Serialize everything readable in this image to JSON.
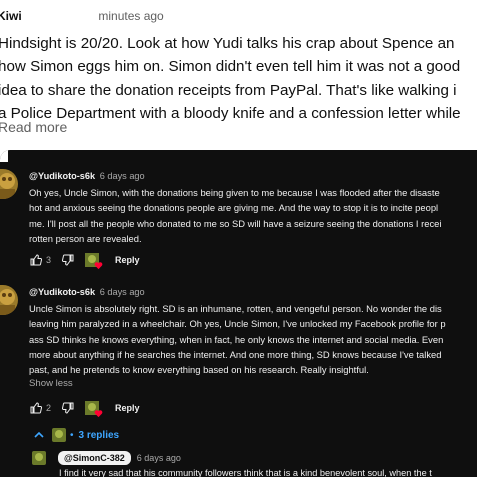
{
  "top_comment": {
    "author": "Kiwi",
    "time_fragment": "minutes ago",
    "lines": [
      "Hindsight is 20/20. Look at how Yudi talks his crap about Spence an",
      "how Simon eggs him on. Simon didn't even tell him it was not a good",
      "idea to share the donation receipts from PayPal. That's like walking i",
      "a Police Department with a bloody knife and a confession letter while"
    ],
    "read_more": "Read more"
  },
  "replies": [
    {
      "handle": "@Yudikoto-s6k",
      "ago": "6 days ago",
      "lines": [
        "Oh yes, Uncle Simon, with the donations being given to me because I was flooded after the disaste",
        "hot and anxious seeing the donations people are giving me. And the way to stop it is to incite peopl",
        "me. I'll post all the people who donated to me so SD will have a seizure seeing the donations I recei",
        "rotten person are revealed."
      ],
      "likes": "3",
      "reply_label": "Reply"
    },
    {
      "handle": "@Yudikoto-s6k",
      "ago": "6 days ago",
      "lines": [
        "Uncle Simon is absolutely right. SD is an inhumane, rotten, and vengeful person. No wonder the dis",
        "leaving him paralyzed in a wheelchair. Oh yes, Uncle Simon, I've unlocked my Facebook profile for p",
        "ass SD thinks he knows everything, when in fact, he only knows the internet and social media. Even",
        "more about anything if he searches the internet. And one more thing, SD knows because I've talked",
        "past, and he pretends to know everything based on his research. Really insightful."
      ],
      "show_less": "Show less",
      "likes": "2",
      "reply_label": "Reply"
    }
  ],
  "thread": {
    "replies_count": "3 replies"
  },
  "sub_reply": {
    "handle": "@SimonC-382",
    "ago": "6 days ago",
    "text": "I find it very sad that his community followers think that is a kind benevolent soul, when the t"
  },
  "colors": {
    "dark_bg": "#0f0f0f",
    "link_blue": "#3ea6ff",
    "heart_red": "#ff0033"
  },
  "icons": [
    "thumbs-up-icon",
    "thumbs-down-icon",
    "chevron-up-icon",
    "heart-icon"
  ]
}
